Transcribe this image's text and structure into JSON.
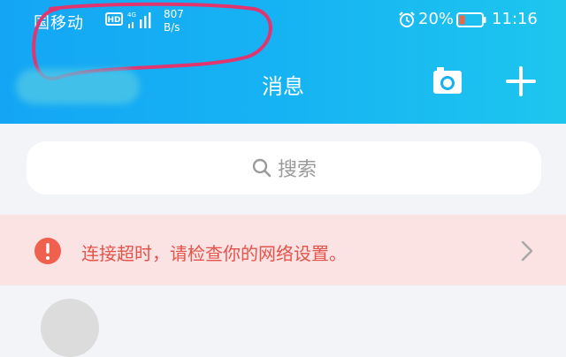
{
  "status_bar": {
    "carrier": "国移动",
    "hd_badge": "HD",
    "network_type": "4G",
    "net_speed_value": "807",
    "net_speed_unit": "B/s",
    "battery_percent": "20%",
    "time": "11:16"
  },
  "header": {
    "title": "消息",
    "icons": [
      "camera-icon",
      "plus-icon"
    ]
  },
  "search": {
    "placeholder": "搜索"
  },
  "error_banner": {
    "message": "连接超时，请检查你的网络设置。"
  },
  "colors": {
    "header_start": "#14a6f5",
    "header_end": "#1ec6ee",
    "error_text": "#e5534b",
    "error_icon": "#f0604f",
    "banner_bg": "#fbe3e3",
    "page_bg": "#f3f4f7",
    "scribble": "#e0356f",
    "battery_low": "#f06543"
  }
}
